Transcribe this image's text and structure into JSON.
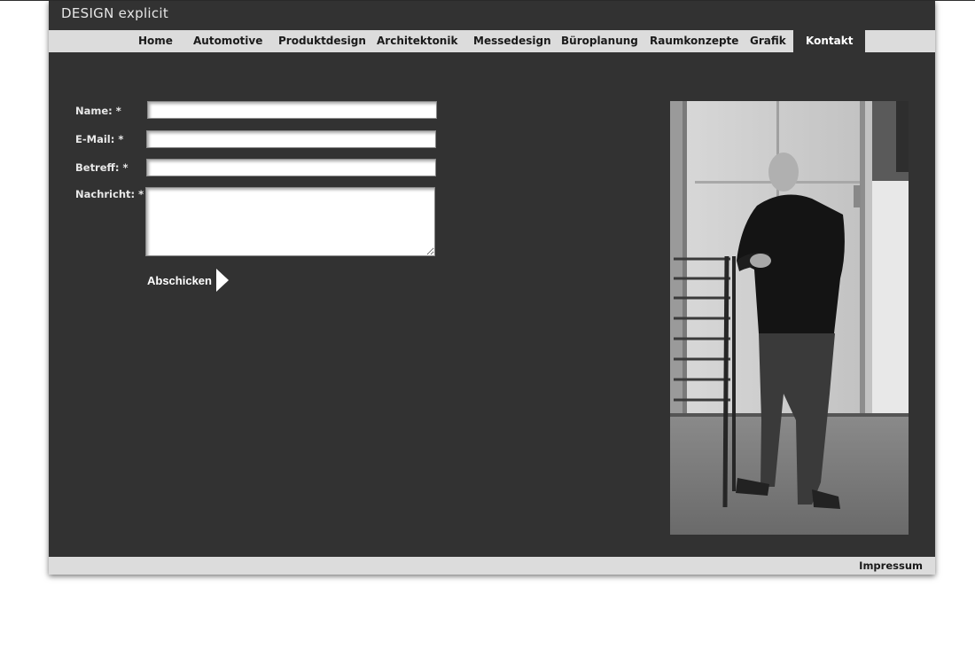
{
  "header": {
    "logo": "DESIGN explicit"
  },
  "nav": {
    "items": [
      {
        "label": "Home"
      },
      {
        "label": "Automotive"
      },
      {
        "label": "Produktdesign"
      },
      {
        "label": "Architektonik"
      },
      {
        "label": "Messedesign"
      },
      {
        "label": "Büroplanung"
      },
      {
        "label": "Raumkonzepte"
      },
      {
        "label": "Grafik"
      },
      {
        "label": "Kontakt",
        "active": true
      }
    ]
  },
  "form": {
    "name_label": "Name: *",
    "name_value": "",
    "email_label": "E-Mail: *",
    "email_value": "",
    "subject_label": "Betreff: *",
    "subject_value": "",
    "message_label": "Nachricht: *",
    "message_value": "",
    "submit_label": "Abschicken"
  },
  "photo": {
    "icon": "person-photo",
    "style": "black-and-white"
  },
  "footer": {
    "impressum": "Impressum"
  },
  "colors": {
    "page_bg": "#ffffff",
    "frame_bg": "#323232",
    "bar_bg": "#dcdcdc",
    "text_light": "#e8e8e8",
    "text_dark": "#1a1a1a"
  }
}
